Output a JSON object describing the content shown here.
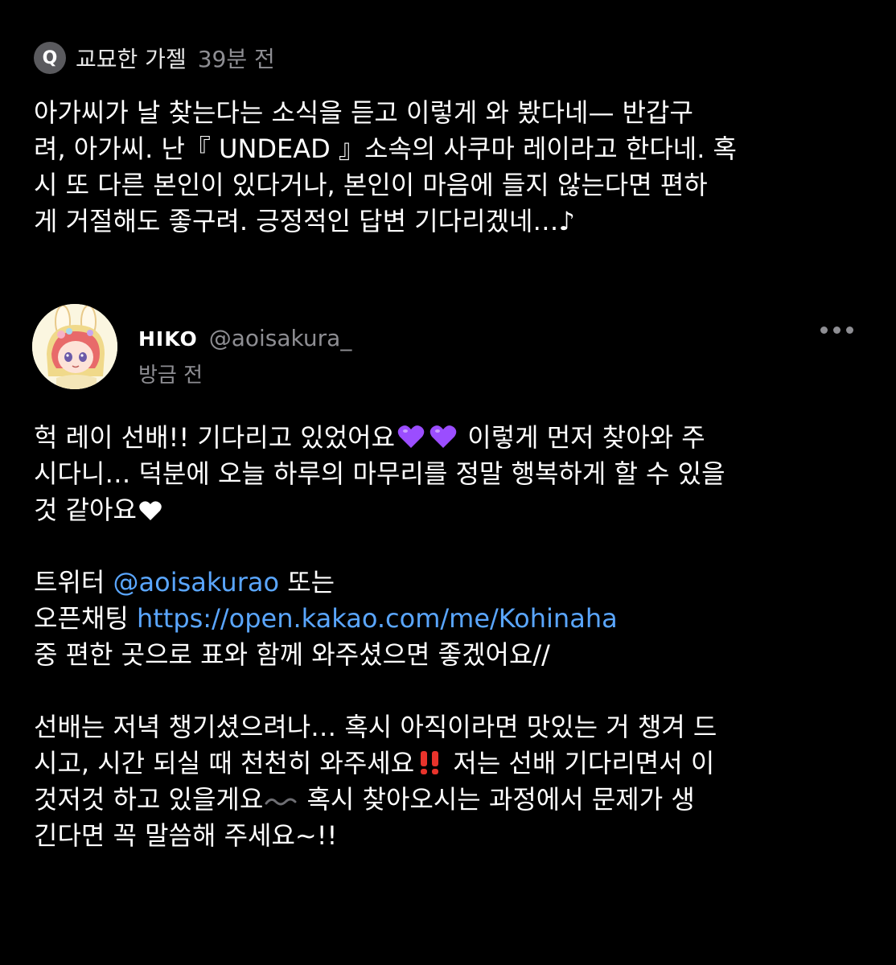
{
  "question": {
    "badge": "Q",
    "author": "교묘한 가젤",
    "time": "39분 전",
    "lines": [
      "아가씨가 날 찾는다는 소식을 듣고 이렇게 와 봤다네— 반갑구",
      "려, 아가씨. 난『 UNDEAD 』소속의 사쿠마 레이라고 한다네. 혹",
      "시 또 다른 본인이 있다거나, 본인이 마음에 들지 않는다면 편하",
      "게 거절해도 좋구려. 긍정적인 답변 기다리겠네…♪"
    ]
  },
  "answer": {
    "name": "HIKO",
    "handle": "@aoisakura_",
    "time": "방금 전",
    "line1_a": "헉 레이 선배!! 기다리고 있었어요",
    "line1_b": " 이렇게 먼저 찾아와 주",
    "line2": "시다니… 덕분에 오늘 하루의 마무리를 정말 행복하게 할 수 있을",
    "line3": "것 같아요",
    "twitter_prefix": "트위터 ",
    "twitter_handle": "@aoisakurao",
    "twitter_suffix": " 또는",
    "openchat_prefix": "오픈채팅 ",
    "openchat_link": "https://open.kakao.com/me/Kohinaha",
    "line_choose": "중 편한 곳으로 표와 함께 와주셨으면 좋겠어요//",
    "para3_line1": "선배는 저녁 챙기셨으려나… 혹시 아직이라면 맛있는 거 챙겨 드",
    "para3_line2_a": "시고, 시간 되실 때 천천히 와주세요",
    "para3_line2_b": " 저는 선배 기다리면서 이",
    "para3_line3_a": "것저것 하고 있을게요",
    "para3_line3_b": " 혹시 찾아오시는 과정에서 문제가 생",
    "para3_line4": "긴다면 꼭 말씀해 주세요~!!"
  },
  "icons": {
    "badge": "q-badge-icon",
    "more": "more-options-icon",
    "purple_heart": "purple-heart-emoji",
    "white_heart": "white-heart-emoji",
    "double_exclamation": "double-exclamation-emoji",
    "wavy_dash": "wavy-dash-emoji"
  },
  "colors": {
    "background": "#000000",
    "text": "#ffffff",
    "muted": "#8e8e93",
    "link": "#5aa6ff",
    "purple_heart": "#9b4dff",
    "exclamation": "#e8332b"
  }
}
